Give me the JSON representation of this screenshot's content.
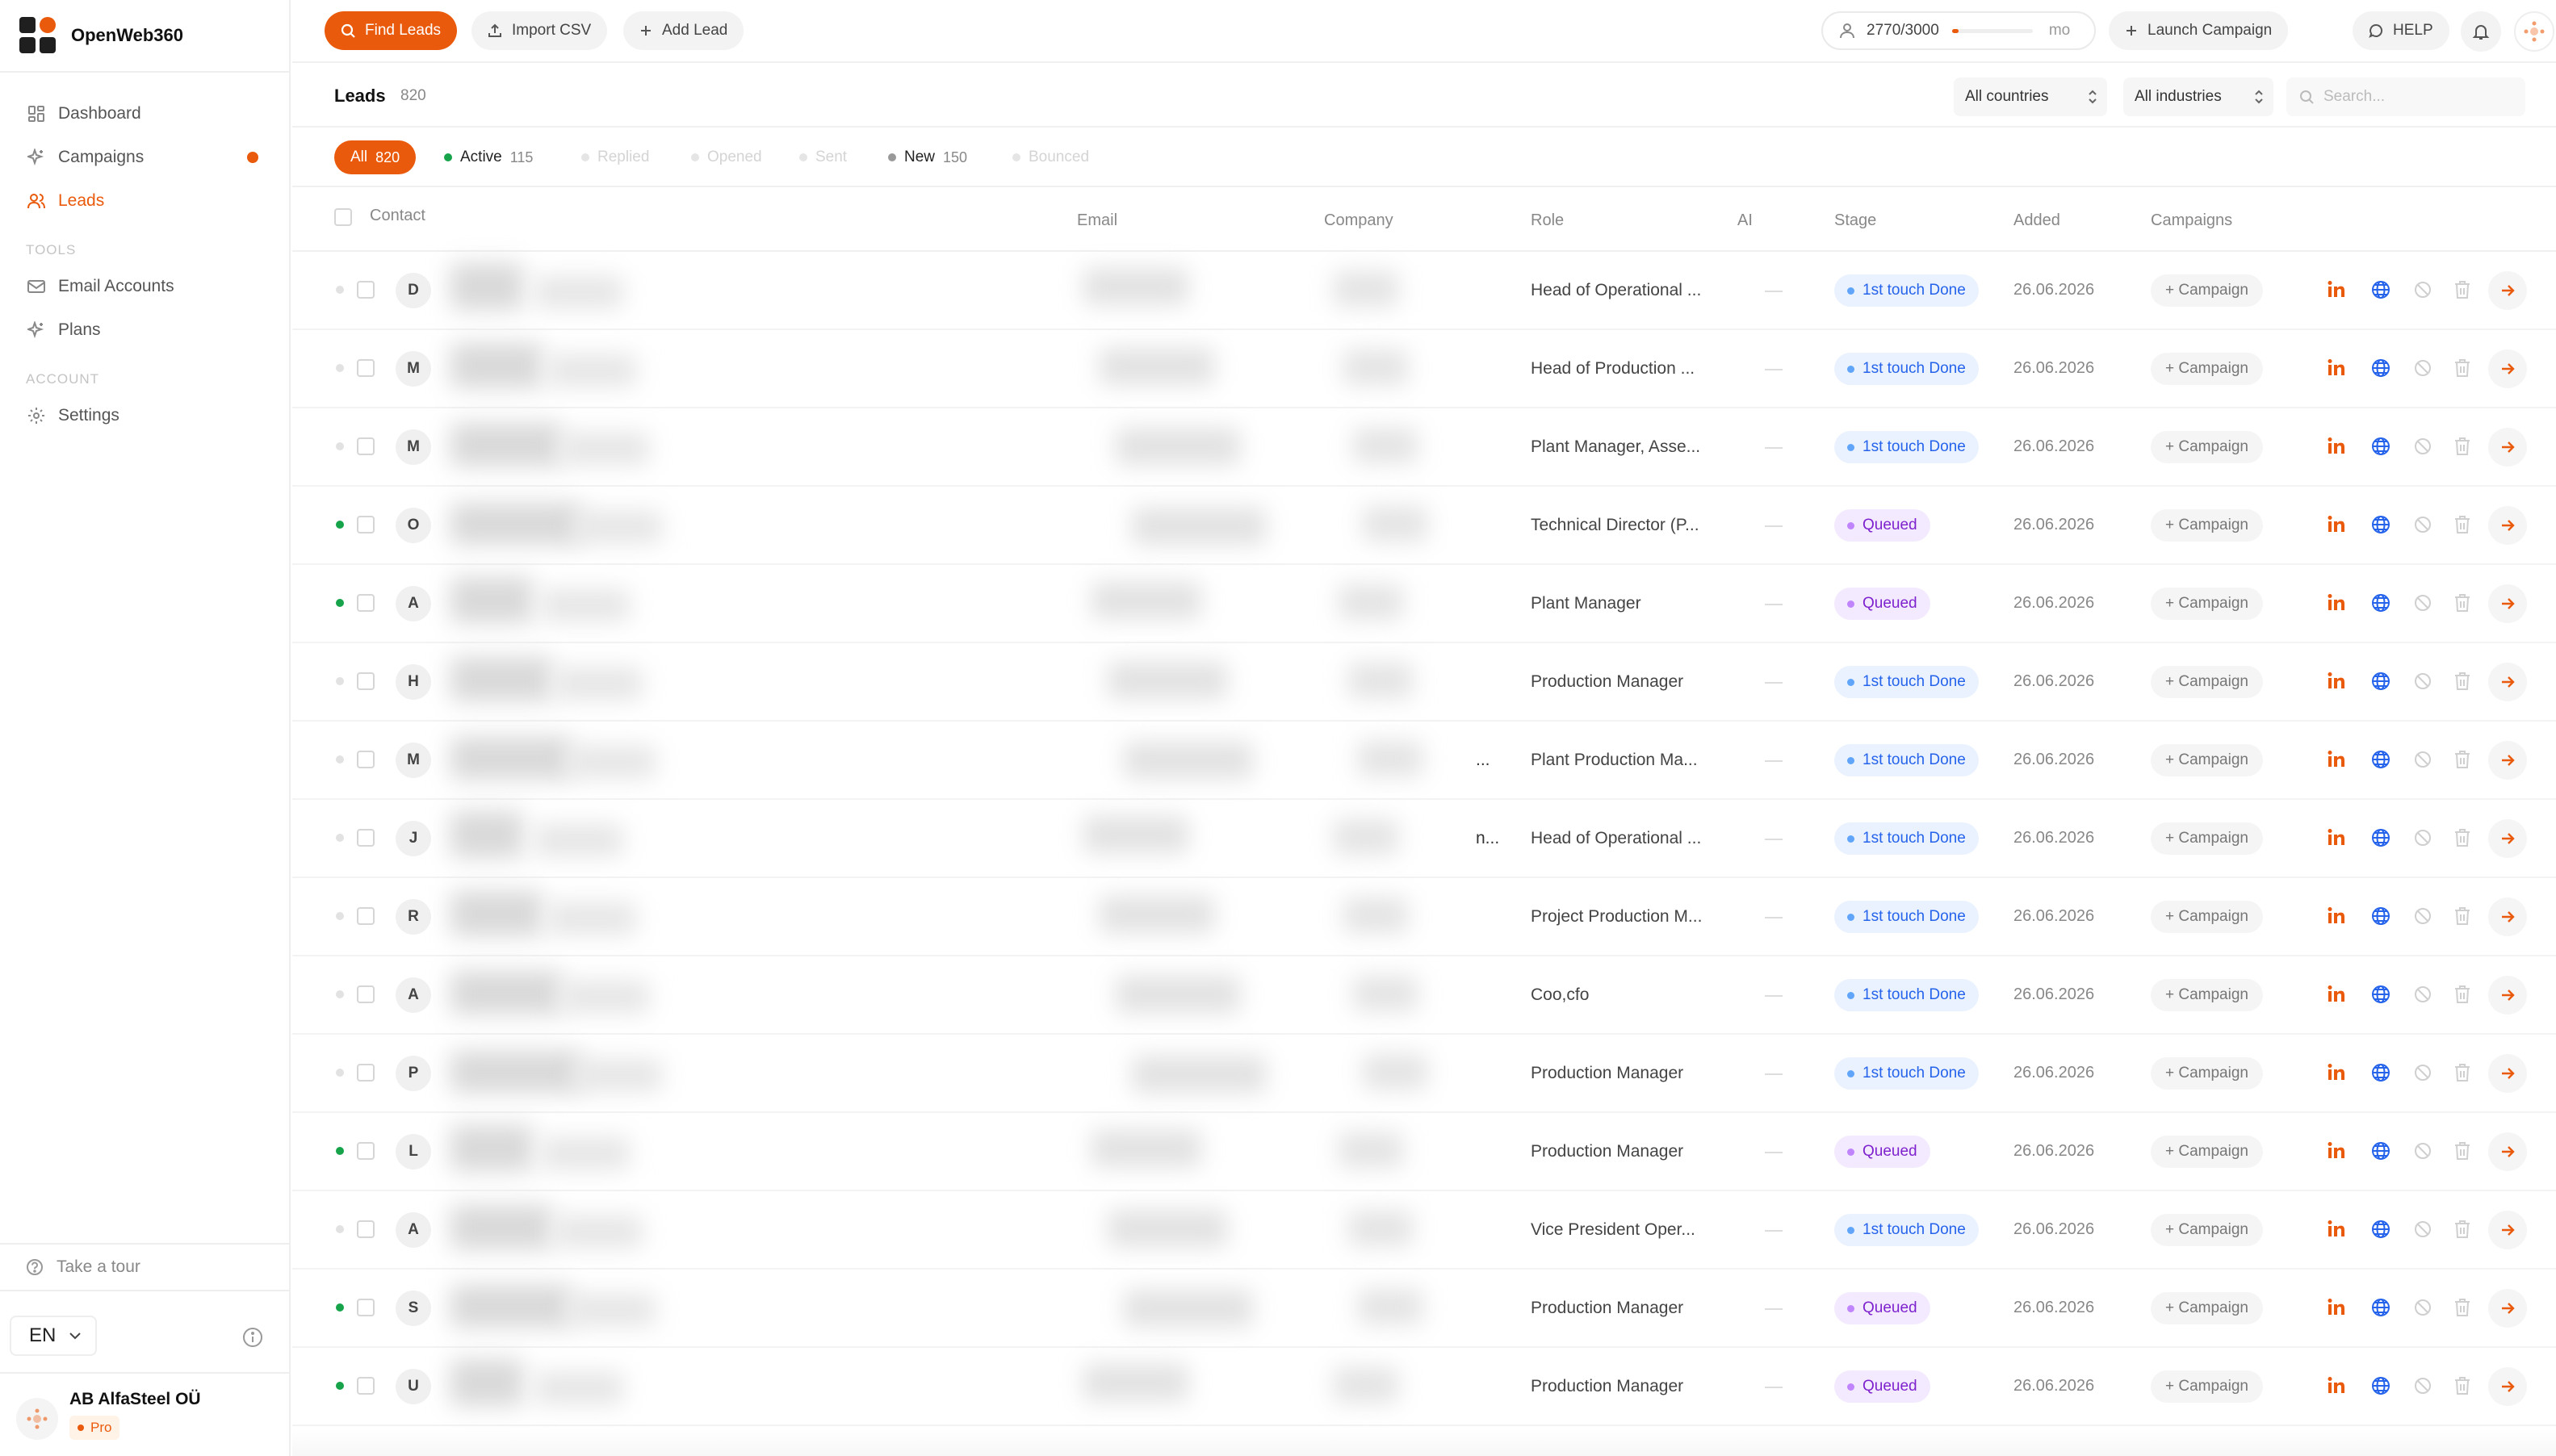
{
  "app": {
    "name": "OpenWeb360"
  },
  "sidebar": {
    "items": [
      {
        "label": "Dashboard",
        "icon": "dashboard-icon"
      },
      {
        "label": "Campaigns",
        "icon": "sparkle-icon",
        "has_dot": true
      },
      {
        "label": "Leads",
        "icon": "users-icon",
        "active": true
      }
    ],
    "tools_heading": "TOOLS",
    "tools": [
      {
        "label": "Email Accounts",
        "icon": "mail-icon"
      },
      {
        "label": "Plans",
        "icon": "sparkle-icon"
      }
    ],
    "account_heading": "ACCOUNT",
    "account_items": [
      {
        "label": "Settings",
        "icon": "gear-icon"
      }
    ],
    "tour_label": "Take a tour",
    "language": "EN",
    "account": {
      "name": "AB AlfaSteel OÜ",
      "plan": "Pro"
    }
  },
  "topbar": {
    "find_leads": "Find Leads",
    "import_csv": "Import CSV",
    "add_lead": "Add Lead",
    "credits": {
      "text": "2770/3000",
      "used_fraction": 0.08,
      "period": "mo"
    },
    "launch_campaign": "Launch Campaign",
    "help": "HELP"
  },
  "leads_header": {
    "title": "Leads",
    "count": "820",
    "country_filter": "All countries",
    "industry_filter": "All industries",
    "search_placeholder": "Search..."
  },
  "filters": [
    {
      "label": "All",
      "count": "820",
      "active": true
    },
    {
      "label": "Active",
      "count": "115",
      "dot_color": "#16a34a"
    },
    {
      "label": "Replied",
      "count": "",
      "dimmed": true
    },
    {
      "label": "Opened",
      "count": "",
      "dimmed": true
    },
    {
      "label": "Sent",
      "count": "",
      "dimmed": true
    },
    {
      "label": "New",
      "count": "150",
      "dot_color": "#999999"
    },
    {
      "label": "Bounced",
      "count": "",
      "dimmed": true
    }
  ],
  "table": {
    "columns": {
      "contact": "Contact",
      "email": "Email",
      "company": "Company",
      "role": "Role",
      "ai": "AI",
      "stage": "Stage",
      "added": "Added",
      "campaigns": "Campaigns"
    },
    "campaign_button": "+ Campaign",
    "rows": [
      {
        "initial": "D",
        "role": "Head of Operational ...",
        "stage": "1st touch Done",
        "stage_type": "touch",
        "added": "26.06.2026",
        "active": false,
        "company_text": ""
      },
      {
        "initial": "M",
        "role": "Head of Production ...",
        "stage": "1st touch Done",
        "stage_type": "touch",
        "added": "26.06.2026",
        "active": false,
        "company_text": ""
      },
      {
        "initial": "M",
        "role": "Plant Manager, Asse...",
        "stage": "1st touch Done",
        "stage_type": "touch",
        "added": "26.06.2026",
        "active": false,
        "company_text": ""
      },
      {
        "initial": "O",
        "role": "Technical Director (P...",
        "stage": "Queued",
        "stage_type": "queued",
        "added": "26.06.2026",
        "active": true,
        "company_text": ""
      },
      {
        "initial": "A",
        "role": "Plant Manager",
        "stage": "Queued",
        "stage_type": "queued",
        "added": "26.06.2026",
        "active": true,
        "company_text": ""
      },
      {
        "initial": "H",
        "role": "Production Manager",
        "stage": "1st touch Done",
        "stage_type": "touch",
        "added": "26.06.2026",
        "active": false,
        "company_text": ""
      },
      {
        "initial": "M",
        "role": "Plant Production Ma...",
        "stage": "1st touch Done",
        "stage_type": "touch",
        "added": "26.06.2026",
        "active": false,
        "company_text": "..."
      },
      {
        "initial": "J",
        "role": "Head of Operational ...",
        "stage": "1st touch Done",
        "stage_type": "touch",
        "added": "26.06.2026",
        "active": false,
        "company_text": "n..."
      },
      {
        "initial": "R",
        "role": "Project Production M...",
        "stage": "1st touch Done",
        "stage_type": "touch",
        "added": "26.06.2026",
        "active": false,
        "company_text": ""
      },
      {
        "initial": "A",
        "role": "Coo,cfo",
        "stage": "1st touch Done",
        "stage_type": "touch",
        "added": "26.06.2026",
        "active": false,
        "company_text": ""
      },
      {
        "initial": "P",
        "role": "Production Manager",
        "stage": "1st touch Done",
        "stage_type": "touch",
        "added": "26.06.2026",
        "active": false,
        "company_text": ""
      },
      {
        "initial": "L",
        "role": "Production Manager",
        "stage": "Queued",
        "stage_type": "queued",
        "added": "26.06.2026",
        "active": true,
        "company_text": ""
      },
      {
        "initial": "A",
        "role": "Vice President Oper...",
        "stage": "1st touch Done",
        "stage_type": "touch",
        "added": "26.06.2026",
        "active": false,
        "company_text": ""
      },
      {
        "initial": "S",
        "role": "Production Manager",
        "stage": "Queued",
        "stage_type": "queued",
        "added": "26.06.2026",
        "active": true,
        "company_text": ""
      },
      {
        "initial": "U",
        "role": "Production Manager",
        "stage": "Queued",
        "stage_type": "queued",
        "added": "26.06.2026",
        "active": true,
        "company_text": ""
      }
    ]
  },
  "colors": {
    "accent": "#ea5a0c",
    "active_green": "#16a34a",
    "stage_touch": "#2563eb",
    "stage_queued": "#7e22ce"
  }
}
